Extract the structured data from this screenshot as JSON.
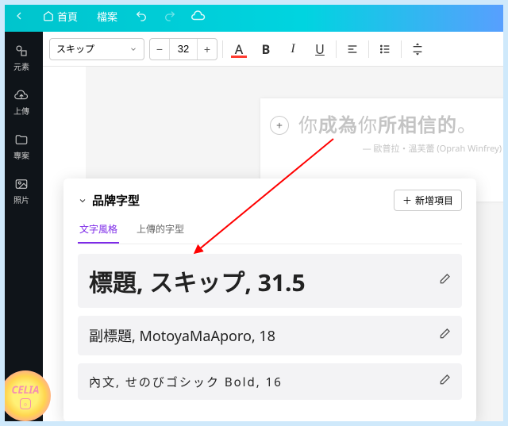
{
  "topbar": {
    "home": "首頁",
    "file": "檔案"
  },
  "sidebar": {
    "items": [
      {
        "label": "元素"
      },
      {
        "label": "上傳"
      },
      {
        "label": "專案"
      },
      {
        "label": "照片"
      }
    ]
  },
  "toolbar": {
    "font_name": "スキップ",
    "font_size": "32",
    "minus": "−",
    "plus": "+",
    "A": "A",
    "B": "B",
    "I": "I",
    "U": "U"
  },
  "canvas": {
    "add": "+",
    "quote_p1": "你",
    "quote_b1": "成為",
    "quote_p2": "你",
    "quote_b2": "所相信的",
    "quote_p3": "。",
    "author": "— 歐普拉・溫芙蕾 (Oprah Winfrey)"
  },
  "panel": {
    "title": "品牌字型",
    "add_item": "新增項目",
    "tabs": {
      "styles": "文字風格",
      "uploaded": "上傳的字型"
    },
    "rows": {
      "h1": "標題, スキップ, 31.5",
      "h2": "副標題, MotoyaMaAporo, 18",
      "body": "內文, せのびゴシック Bold, 16"
    }
  },
  "watermark": {
    "text": "CELIA"
  }
}
